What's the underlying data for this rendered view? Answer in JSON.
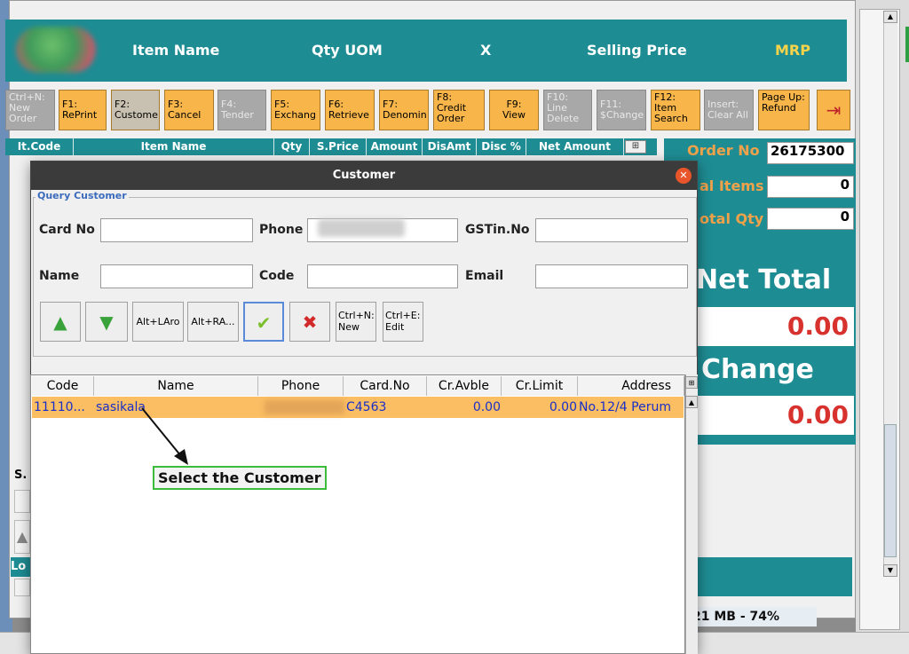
{
  "header": {
    "item_name": "Item Name",
    "qty_uom": "Qty UOM",
    "x": "X",
    "selling_price": "Selling Price",
    "mrp": "MRP"
  },
  "toolbar": {
    "buttons": [
      {
        "key": "Ctrl+N:",
        "label": "New Order",
        "enabled": false
      },
      {
        "key": "F1:",
        "label": "RePrint",
        "enabled": true
      },
      {
        "key": "F2:",
        "label": "Custome",
        "enabled": true
      },
      {
        "key": "F3:",
        "label": "Cancel",
        "enabled": true
      },
      {
        "key": "F4:",
        "label": "Tender",
        "enabled": false
      },
      {
        "key": "F5:",
        "label": "Exchang",
        "enabled": true
      },
      {
        "key": "F6:",
        "label": "Retrieve",
        "enabled": true
      },
      {
        "key": "F7:",
        "label": "Denomin",
        "enabled": true
      },
      {
        "key": "F8:",
        "label": "Credit Order",
        "enabled": true
      },
      {
        "key": "F9:",
        "label": "View",
        "enabled": true
      },
      {
        "key": "F10:",
        "label": "Line Delete",
        "enabled": false
      },
      {
        "key": "F11:",
        "label": "$Change",
        "enabled": false
      },
      {
        "key": "F12:",
        "label": "Item Search",
        "enabled": true
      },
      {
        "key": "Insert:",
        "label": "Clear All",
        "enabled": false
      },
      {
        "key": "Page Up:",
        "label": "Refund",
        "enabled": true
      }
    ]
  },
  "grid": {
    "columns": [
      "It.Code",
      "Item Name",
      "Qty",
      "S.Price",
      "Amount",
      "DisAmt",
      "Disc %",
      "Net Amount"
    ]
  },
  "side": {
    "order_no_label": "Order No",
    "order_no_value": "26175300",
    "total_items_label": "al Items",
    "total_items_value": "0",
    "total_qty_label": "otal Qty",
    "total_qty_value": "0",
    "net_total_label": "Net Total",
    "net_total_value": "0.00",
    "change_label": "Change",
    "change_value": "0.00"
  },
  "left_fragments": {
    "s_label": "S.",
    "lo_label": "Lo"
  },
  "status": {
    "memory": "21 MB - 74%"
  },
  "dialog": {
    "title": "Customer",
    "close_glyph": "✕",
    "group_title": "Query Customer",
    "fields": {
      "card_no_label": "Card No",
      "card_no_value": "",
      "phone_label": "Phone",
      "phone_value": "",
      "gstin_label": "GSTin.No",
      "gstin_value": "",
      "name_label": "Name",
      "name_value": "",
      "code_label": "Code",
      "code_value": "",
      "email_label": "Email",
      "email_value": ""
    },
    "buttons": {
      "up_icon": "▲",
      "down_icon": "▼",
      "alt_larrow": "Alt+LAro",
      "alt_rarrow": "Alt+RA...",
      "ok_icon": "✔",
      "cancel_icon": "✖",
      "new_key": "Ctrl+N:",
      "new_label": "New",
      "edit_key": "Ctrl+E:",
      "edit_label": "Edit"
    },
    "list": {
      "columns": [
        "Code",
        "Name",
        "Phone",
        "Card.No",
        "Cr.Avble",
        "Cr.Limit",
        "Address"
      ],
      "rows": [
        {
          "code": "11110...",
          "name": "sasikala",
          "phone": "",
          "card_no": "C4563",
          "cr_avble": "0.00",
          "cr_limit": "0.00",
          "address": "No.12/4 Perum"
        }
      ]
    }
  },
  "annotation": {
    "text": "Select the Customer"
  },
  "colors": {
    "teal": "#1e8c93",
    "orange_button": "#f7b54a",
    "selected_row": "#fbbe62",
    "accent_red": "#d8322e"
  }
}
